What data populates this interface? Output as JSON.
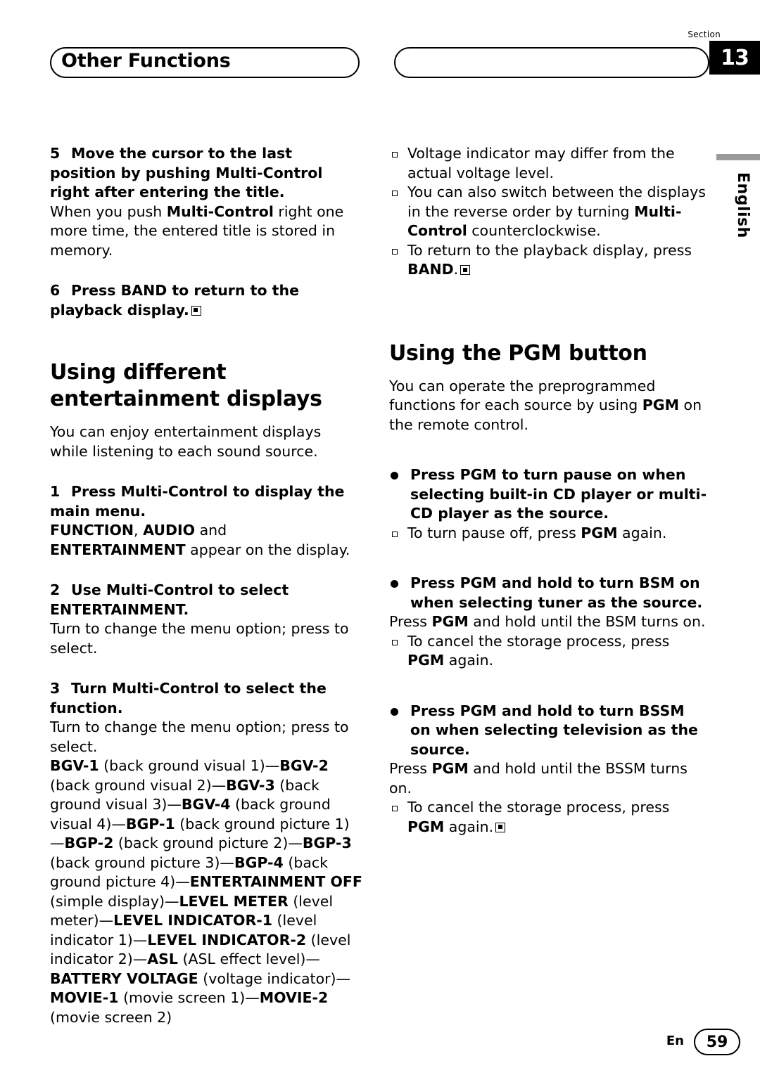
{
  "header": {
    "section_label": "Section",
    "section_number": "13",
    "title": "Other Functions",
    "side_tab": "English"
  },
  "left_column": {
    "step5": {
      "num": "5",
      "heading": "Move the cursor to the last position by pushing Multi-Control right after entering the title.",
      "body_1": "When you push ",
      "body_b1": "Multi-Control",
      "body_2": " right one more time, the entered title is stored in memory."
    },
    "step6": {
      "num": "6",
      "heading": "Press BAND to return to the playback display."
    },
    "h2_entertainment": "Using different entertainment displays",
    "intro": "You can enjoy entertainment displays while listening to each sound source.",
    "step1": {
      "num": "1",
      "heading": "Press Multi-Control to display the main menu.",
      "body_b1": "FUNCTION",
      "body_1": ", ",
      "body_b2": "AUDIO",
      "body_2": " and ",
      "body_b3": "ENTERTAINMENT",
      "body_3": " appear on the display."
    },
    "step2": {
      "num": "2",
      "heading": "Use Multi-Control to select ENTERTAINMENT.",
      "body": "Turn to change the menu option; press to select."
    },
    "step3": {
      "num": "3",
      "heading": "Turn Multi-Control to select the function.",
      "body": "Turn to change the menu option; press to select."
    },
    "option_chain": [
      {
        "bold": "BGV-1",
        "plain": " (back ground visual 1)—"
      },
      {
        "bold": "BGV-2",
        "plain": " (back ground visual 2)—"
      },
      {
        "bold": "BGV-3",
        "plain": " (back ground visual 3)—"
      },
      {
        "bold": "BGV-4",
        "plain": " (back ground visual 4)—"
      },
      {
        "bold": "BGP-1",
        "plain": " (back ground picture 1)—"
      },
      {
        "bold": "BGP-2",
        "plain": " (back ground picture 2)—"
      },
      {
        "bold": "BGP-3",
        "plain": " (back ground picture 3)—"
      },
      {
        "bold": "BGP-4",
        "plain": " (back ground picture 4)—"
      },
      {
        "bold": "ENTERTAINMENT OFF",
        "plain": " (simple display)—"
      },
      {
        "bold": "LEVEL METER",
        "plain": " (level meter)—"
      },
      {
        "bold": "LEVEL INDICATOR-1",
        "plain": " (level indicator 1)—"
      },
      {
        "bold": "LEVEL INDICATOR-2",
        "plain": " (level indicator 2)—"
      },
      {
        "bold": "ASL",
        "plain": " (ASL effect level)—"
      },
      {
        "bold": "BATTERY VOLTAGE",
        "plain": " (voltage indicator)—"
      },
      {
        "bold": "MOVIE-1",
        "plain": " (movie screen 1)—"
      },
      {
        "bold": "MOVIE-2",
        "plain": " (movie screen 2)"
      }
    ]
  },
  "right_column": {
    "note_1": "Voltage indicator may differ from the actual voltage level.",
    "note_2_a": "You can also switch between the displays in the reverse order by turning ",
    "note_2_b": "Multi-Control",
    "note_2_c": " counterclockwise.",
    "note_3_a": "To return to the playback display, press ",
    "note_3_b": "BAND",
    "note_3_c": ".",
    "h2_pgm": "Using the PGM button",
    "pgm_intro_a": "You can operate the preprogrammed functions for each source by using ",
    "pgm_intro_b": "PGM",
    "pgm_intro_c": " on the remote control.",
    "b1_heading": "Press PGM to turn pause on when selecting built-in CD player or multi-CD player as the source.",
    "b1_note_a": "To turn pause off, press ",
    "b1_note_b": "PGM",
    "b1_note_c": " again.",
    "b2_heading": "Press PGM and hold to turn BSM on when selecting tuner as the source.",
    "b2_body_a": "Press ",
    "b2_body_b": "PGM",
    "b2_body_c": " and hold until the BSM turns on.",
    "b2_note_a": "To cancel the storage process, press ",
    "b2_note_b": "PGM",
    "b2_note_c": " again.",
    "b3_heading": "Press PGM and hold to turn BSSM on when selecting television as the source.",
    "b3_body_a": "Press ",
    "b3_body_b": "PGM",
    "b3_body_c": " and hold until the BSSM turns on.",
    "b3_note_a": "To cancel the storage process, press ",
    "b3_note_b": "PGM",
    "b3_note_c": " again."
  },
  "footer": {
    "lang": "En",
    "page": "59"
  }
}
